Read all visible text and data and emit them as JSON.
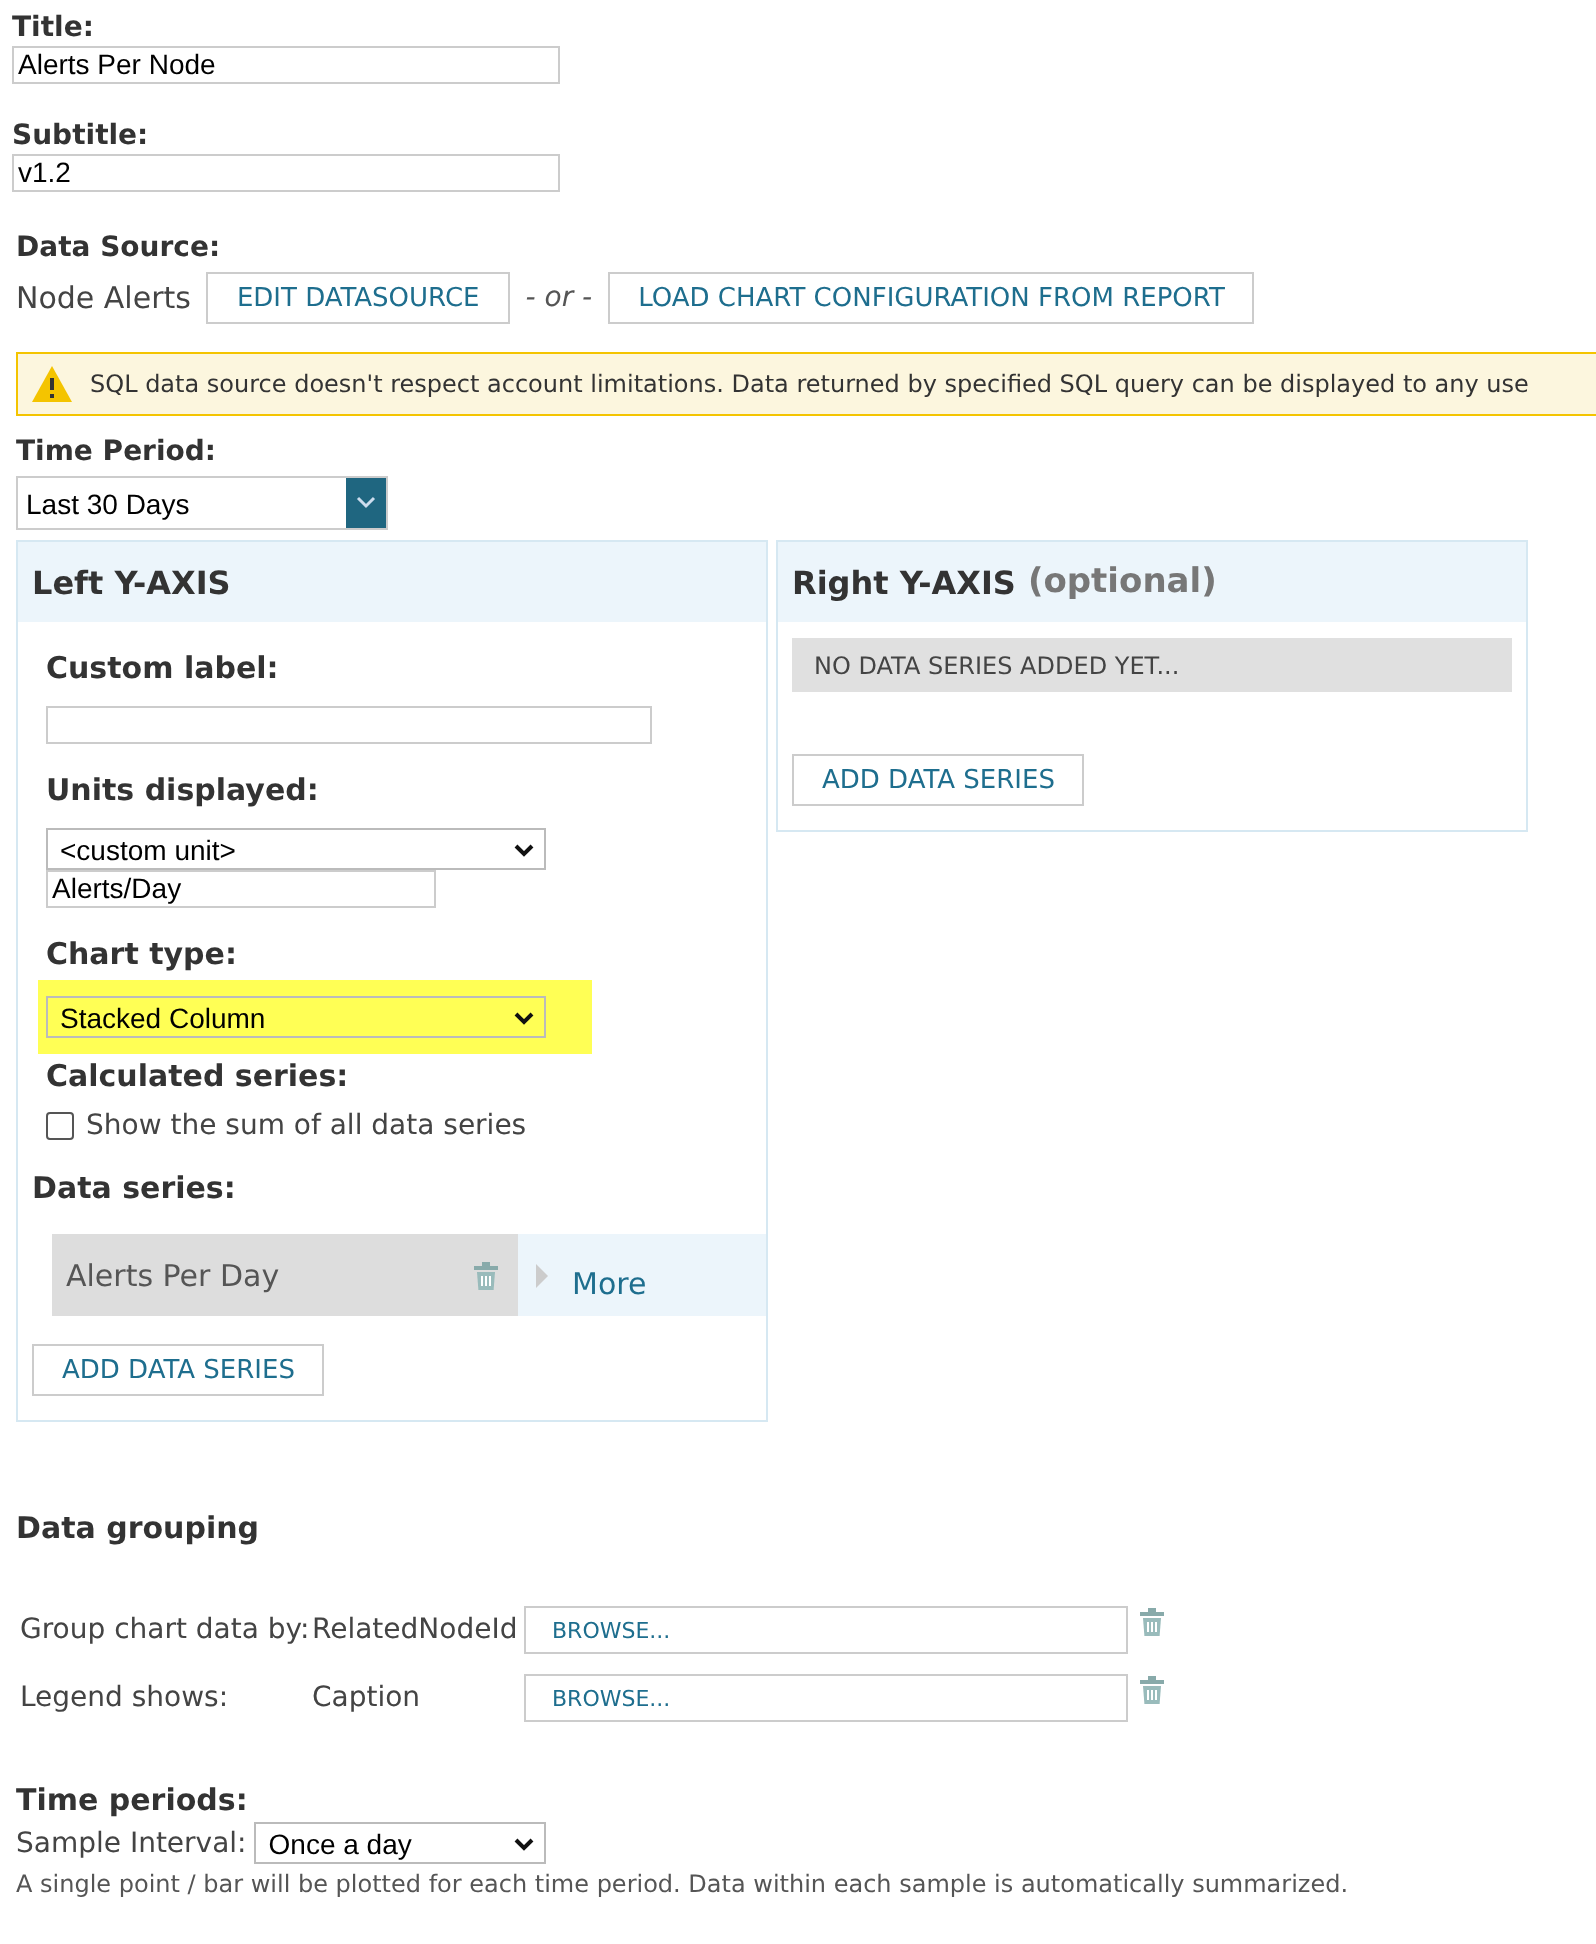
{
  "title_field": {
    "label": "Title:",
    "value": "Alerts Per Node"
  },
  "subtitle_field": {
    "label": "Subtitle:",
    "value": "v1.2"
  },
  "data_source": {
    "label": "Data Source:",
    "name": "Node Alerts",
    "edit_button": "EDIT DATASOURCE",
    "separator": "- or -",
    "load_button": "LOAD CHART CONFIGURATION FROM REPORT"
  },
  "warning": "SQL data source doesn't respect account limitations. Data returned by specified SQL query can be displayed to any use",
  "time_period": {
    "label": "Time Period:",
    "value": "Last 30 Days"
  },
  "left_axis": {
    "title": "Left Y-AXIS",
    "custom_label_heading": "Custom label:",
    "units_heading": "Units displayed:",
    "units_select": "<custom unit>",
    "units_value": "Alerts/Day",
    "chart_type_heading": "Chart type:",
    "chart_type": "Stacked Column",
    "chart_type_highlighted": true,
    "calculated_heading": "Calculated series:",
    "sum_checkbox": {
      "label": "Show the sum of all data series",
      "checked": false
    },
    "series_heading": "Data series:",
    "series": [
      {
        "name": "Alerts Per Day",
        "more": "More"
      }
    ],
    "add_button": "ADD DATA SERIES"
  },
  "right_axis": {
    "title": "Right Y-AXIS",
    "title_note": "(optional)",
    "empty_message": "NO DATA SERIES ADDED YET...",
    "add_button": "ADD DATA SERIES"
  },
  "data_grouping": {
    "heading": "Data grouping",
    "rows": [
      {
        "label": "Group chart data by:",
        "value": "RelatedNodeId",
        "button": "BROWSE..."
      },
      {
        "label": "Legend shows:",
        "value": "Caption",
        "button": "BROWSE..."
      }
    ]
  },
  "time_periods": {
    "heading": "Time periods:",
    "interval_label": "Sample Interval:",
    "interval_value": "Once a day",
    "note": "A single point / bar will be plotted for each time period. Data within each sample is automatically summarized."
  }
}
